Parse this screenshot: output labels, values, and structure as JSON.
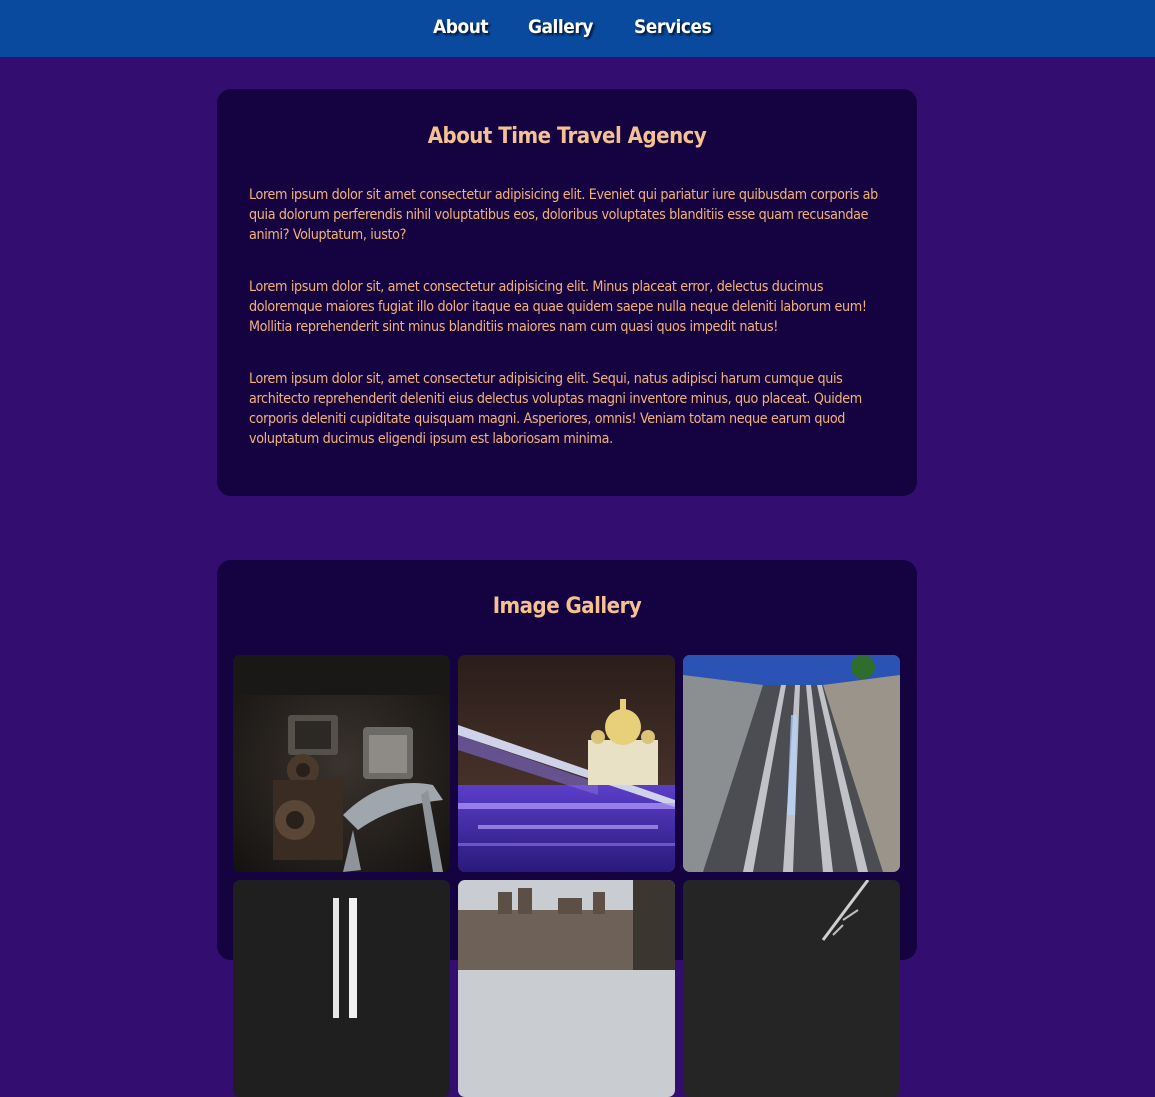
{
  "nav": {
    "items": [
      {
        "label": "About"
      },
      {
        "label": "Gallery"
      },
      {
        "label": "Services"
      }
    ]
  },
  "about": {
    "title": "About Time Travel Agency",
    "paragraphs": [
      "Lorem ipsum dolor sit amet consectetur adipisicing elit. Eveniet qui pariatur iure quibusdam corporis ab quia dolorum perferendis nihil voluptatibus eos, doloribus voluptates blanditiis esse quam recusandae animi? Voluptatum, iusto?",
      "Lorem ipsum dolor sit, amet consectetur adipisicing elit. Minus placeat error, delectus ducimus doloremque maiores fugiat illo dolor itaque ea quae quidem saepe nulla neque deleniti laborum eum! Mollitia reprehenderit sint minus blanditiis maiores nam cum quasi quos impedit natus!",
      "Lorem ipsum dolor sit, amet consectetur adipisicing elit. Sequi, natus adipisci harum cumque quis architecto reprehenderit deleniti eius delectus voluptas magni inventore minus, quo placeat. Quidem corporis deleniti cupiditate quisquam magni. Asperiores, omnis! Veniam totam neque earum quod voluptatum ducimus eligendi ipsum est laboriosam minima."
    ]
  },
  "gallery": {
    "title": "Image Gallery",
    "images": [
      {
        "subject": "vintage-machinery-photo"
      },
      {
        "subject": "night-bridge-cathedral-photo"
      },
      {
        "subject": "railway-tracks-photo"
      },
      {
        "subject": "monochrome-abstract-photo"
      },
      {
        "subject": "city-rooftops-photo"
      },
      {
        "subject": "dark-wire-photo"
      }
    ]
  },
  "colors": {
    "page_background": "#330d6f",
    "nav_background": "#0a4a9e",
    "card_background": "#140340",
    "heading": "#f5c193",
    "body_text": "#f3b27a"
  }
}
